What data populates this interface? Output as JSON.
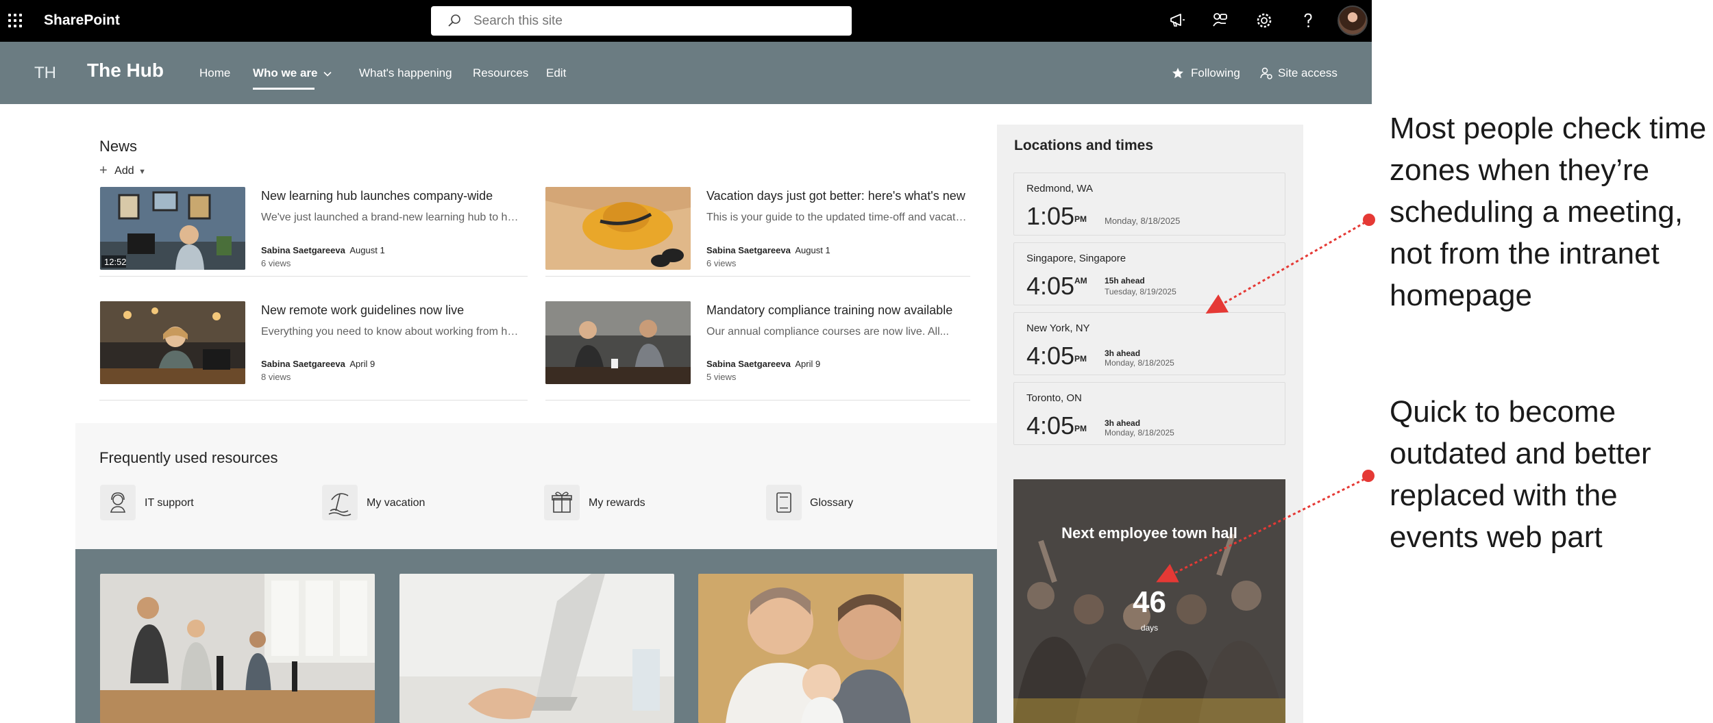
{
  "suitebar": {
    "app_name": "SharePoint",
    "search_placeholder": "Search this site"
  },
  "site": {
    "initials": "TH",
    "title": "The Hub",
    "nav": [
      {
        "label": "Home"
      },
      {
        "label": "Who we are"
      },
      {
        "label": "What's happening"
      },
      {
        "label": "Resources"
      },
      {
        "label": "Edit"
      }
    ],
    "following_label": "Following",
    "site_access_label": "Site access"
  },
  "news": {
    "title": "News",
    "add_label": "Add",
    "items": [
      {
        "title": "New learning hub launches company-wide",
        "desc": "We've just launched a brand-new learning hub to help...",
        "author": "Sabina Saetgareeva",
        "date": "August 1",
        "views": "6 views",
        "overlay": "12:52"
      },
      {
        "title": "Vacation days just got better: here's what's new",
        "desc": "This is your guide to the updated time-off and vacation...",
        "author": "Sabina Saetgareeva",
        "date": "August 1",
        "views": "6 views"
      },
      {
        "title": "New remote work guidelines now live",
        "desc": "Everything you need to know about working from home...",
        "author": "Sabina Saetgareeva",
        "date": "April 9",
        "views": "8 views"
      },
      {
        "title": "Mandatory compliance training now available",
        "desc": "Our annual compliance courses are now live. All...",
        "author": "Sabina Saetgareeva",
        "date": "April 9",
        "views": "5 views"
      }
    ]
  },
  "resources": {
    "title": "Frequently used resources",
    "items": [
      {
        "label": "IT support"
      },
      {
        "label": "My vacation"
      },
      {
        "label": "My rewards"
      },
      {
        "label": "Glossary"
      }
    ]
  },
  "locations": {
    "title": "Locations and times",
    "items": [
      {
        "name": "Redmond, WA",
        "time": "1:05",
        "ampm": "PM",
        "ahead": "",
        "date": "Monday, 8/18/2025"
      },
      {
        "name": "Singapore, Singapore",
        "time": "4:05",
        "ampm": "AM",
        "ahead": "15h ahead",
        "date": "Tuesday, 8/19/2025"
      },
      {
        "name": "New York, NY",
        "time": "4:05",
        "ampm": "PM",
        "ahead": "3h ahead",
        "date": "Monday, 8/18/2025"
      },
      {
        "name": "Toronto, ON",
        "time": "4:05",
        "ampm": "PM",
        "ahead": "3h ahead",
        "date": "Monday, 8/18/2025"
      }
    ]
  },
  "countdown": {
    "title": "Next employee town hall",
    "number": "46",
    "unit": "days"
  },
  "annotations": [
    {
      "text": "Most people check time zones when they’re scheduling a meeting, not from the intranet homepage"
    },
    {
      "text": "Quick to become outdated and better replaced with the events web part"
    }
  ],
  "colors": {
    "suitebar": "#000000",
    "site_header": "#6b7c82",
    "annotation_arrow": "#e53935"
  }
}
